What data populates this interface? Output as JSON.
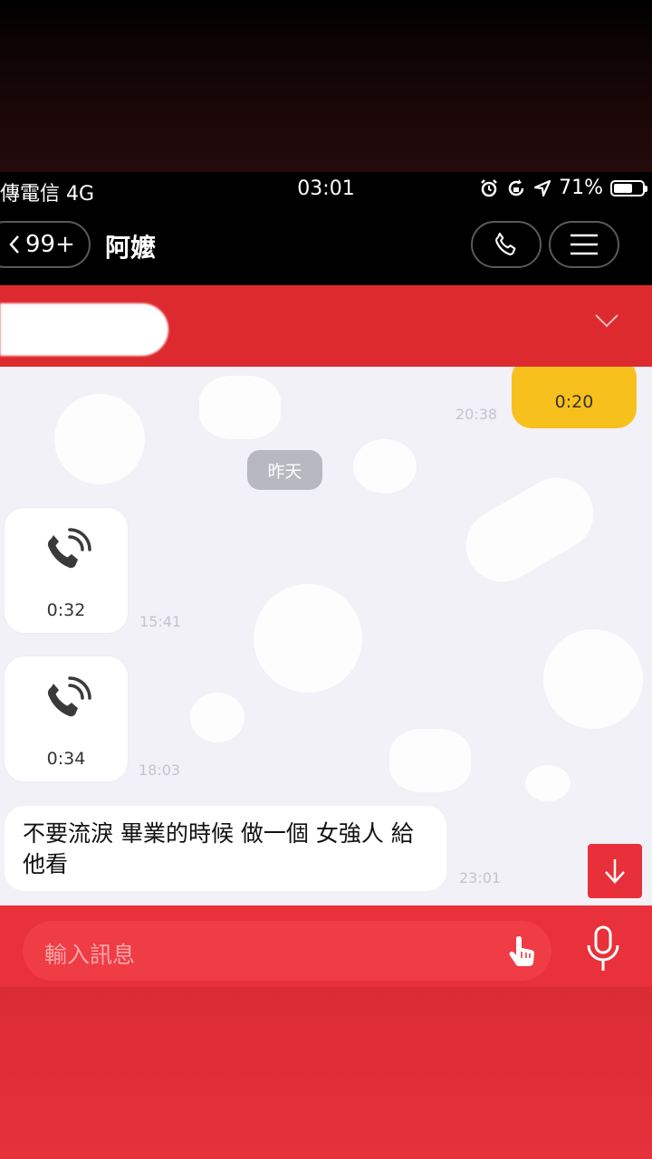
{
  "status_bar": {
    "carrier": "傳電信 4G",
    "time": "03:01",
    "battery_percent": "71%",
    "battery_level": 0.71,
    "icons": [
      "alarm-icon",
      "rotation-lock-icon",
      "location-arrow-icon",
      "battery-icon"
    ]
  },
  "nav": {
    "unread_count": "99+",
    "title": "阿嬤",
    "icons": [
      "back-chevron-icon",
      "phone-icon",
      "menu-icon"
    ]
  },
  "notice": {
    "icons": [
      "chevron-down-icon"
    ]
  },
  "messages": [
    {
      "type": "call",
      "direction": "out",
      "duration": "0:20",
      "time": "20:38"
    },
    {
      "type": "date",
      "text": "昨天"
    },
    {
      "type": "call",
      "direction": "in",
      "duration": "0:32",
      "time": "15:41"
    },
    {
      "type": "call",
      "direction": "in",
      "duration": "0:34",
      "time": "18:03"
    },
    {
      "type": "text",
      "direction": "in",
      "text": "不要流淚 畢業的時候 做一個 女強人 給他看",
      "time": "23:01"
    }
  ],
  "input": {
    "placeholder": "輸入訊息",
    "icons": [
      "hand-pointer-icon",
      "microphone-icon",
      "arrow-down-icon"
    ]
  },
  "colors": {
    "theme_red": "#dd2a2e",
    "own_bubble": "#f7c01c",
    "chat_background": "#f2f1f7"
  }
}
